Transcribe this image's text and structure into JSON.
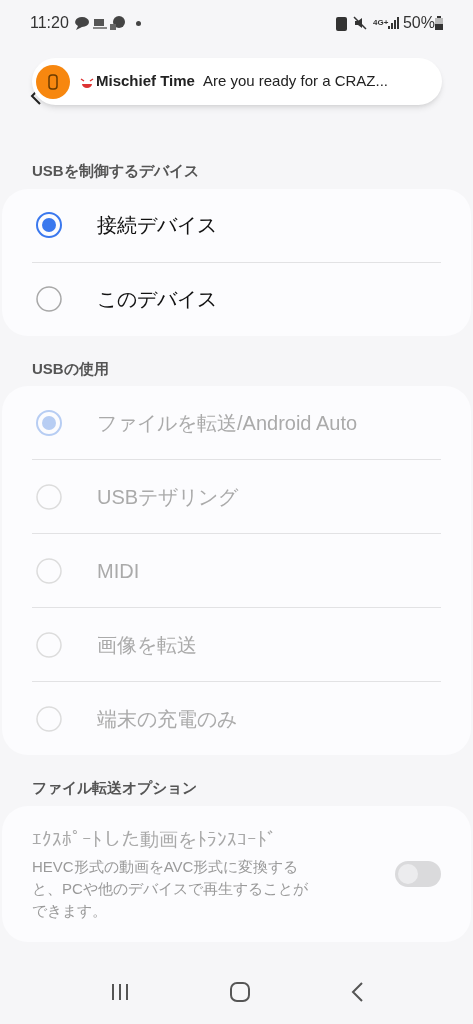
{
  "status_bar": {
    "time": "11:20",
    "battery": "50%",
    "network": "4G+"
  },
  "notification": {
    "app": "Mischief Time",
    "text": "Are you ready for a CRAZ..."
  },
  "sections": [
    {
      "title": "USBを制御するデバイス",
      "kind": "radio",
      "items": [
        {
          "label": "接続デバイス",
          "selected": true,
          "disabled": false
        },
        {
          "label": "このデバイス",
          "selected": false,
          "disabled": false
        }
      ]
    },
    {
      "title": "USBの使用",
      "kind": "radio",
      "items": [
        {
          "label": "ファイルを転送/Android Auto",
          "selected": true,
          "disabled": true
        },
        {
          "label": "USBテザリング",
          "selected": false,
          "disabled": true
        },
        {
          "label": "MIDI",
          "selected": false,
          "disabled": true
        },
        {
          "label": "画像を転送",
          "selected": false,
          "disabled": true
        },
        {
          "label": "端末の充電のみ",
          "selected": false,
          "disabled": true
        }
      ]
    },
    {
      "title": "ファイル転送オプション",
      "kind": "switch",
      "items": [
        {
          "label": "ｴｸｽﾎﾟｰﾄした動画をﾄﾗﾝｽｺｰﾄﾞ",
          "description": "HEVC形式の動画をAVC形式に変換すると、PCや他のデバイスで再生することができます。",
          "on": false,
          "disabled": true
        }
      ]
    }
  ]
}
